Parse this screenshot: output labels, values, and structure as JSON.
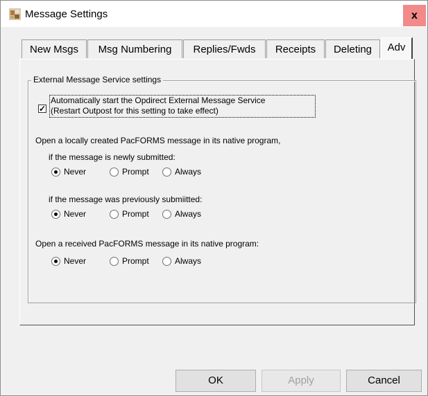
{
  "window": {
    "title": "Message Settings",
    "close_glyph": "x",
    "app_icon": "outpost-app-icon"
  },
  "tabs": [
    {
      "label": "New Msgs"
    },
    {
      "label": "Msg Numbering"
    },
    {
      "label": "Replies/Fwds"
    },
    {
      "label": "Receipts"
    },
    {
      "label": "Deleting"
    },
    {
      "label": "Adv",
      "active": true
    }
  ],
  "group": {
    "legend": "External Message Service settings",
    "auto_start": {
      "line1": "Automatically start the Opdirect External Message Service",
      "line2": "(Restart Outpost for this setting to take effect)",
      "checked": true,
      "check_glyph": "✓"
    },
    "local_heading": "Open a locally created PacFORMS message in its native program,",
    "new_label": "if the message is newly submitted:",
    "prev_label": "if the message was previously submiitted:",
    "received_heading": "Open a received PacFORMS message in its native program:",
    "options": {
      "never": "Never",
      "prompt": "Prompt",
      "always": "Always"
    },
    "selected": {
      "new": "never",
      "prev": "never",
      "received": "never"
    }
  },
  "buttons": {
    "ok": "OK",
    "apply": "Apply",
    "cancel": "Cancel"
  },
  "colors": {
    "close_button": "#f28a8a",
    "dialog_bg": "#f0f0f0"
  }
}
